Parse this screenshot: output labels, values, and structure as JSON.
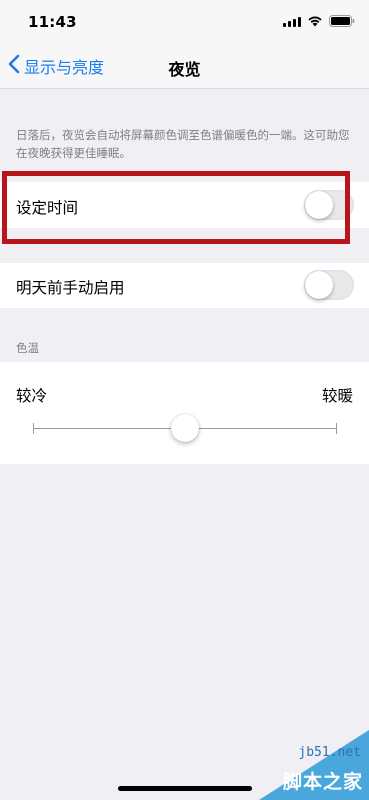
{
  "status_bar": {
    "time": "11:43",
    "icons": [
      "signal-icon",
      "wifi-icon",
      "battery-icon"
    ]
  },
  "nav": {
    "back_label": "显示与亮度",
    "title": "夜览",
    "accent_color": "#1a7bf2"
  },
  "description": "日落后，夜览会自动将屏幕颜色调至色谱偏暖色的一端。这可助您在夜晚获得更佳睡眠。",
  "settings": {
    "scheduled": {
      "label": "设定时间",
      "on": false
    },
    "manual": {
      "label": "明天前手动启用",
      "on": false
    }
  },
  "highlight_color": "#b5151b",
  "color_temperature": {
    "section_title": "色温",
    "cool_label": "较冷",
    "warm_label": "较暖",
    "value": 0.5
  },
  "watermark": {
    "site": "jb51.net",
    "name": "脚本之家"
  }
}
